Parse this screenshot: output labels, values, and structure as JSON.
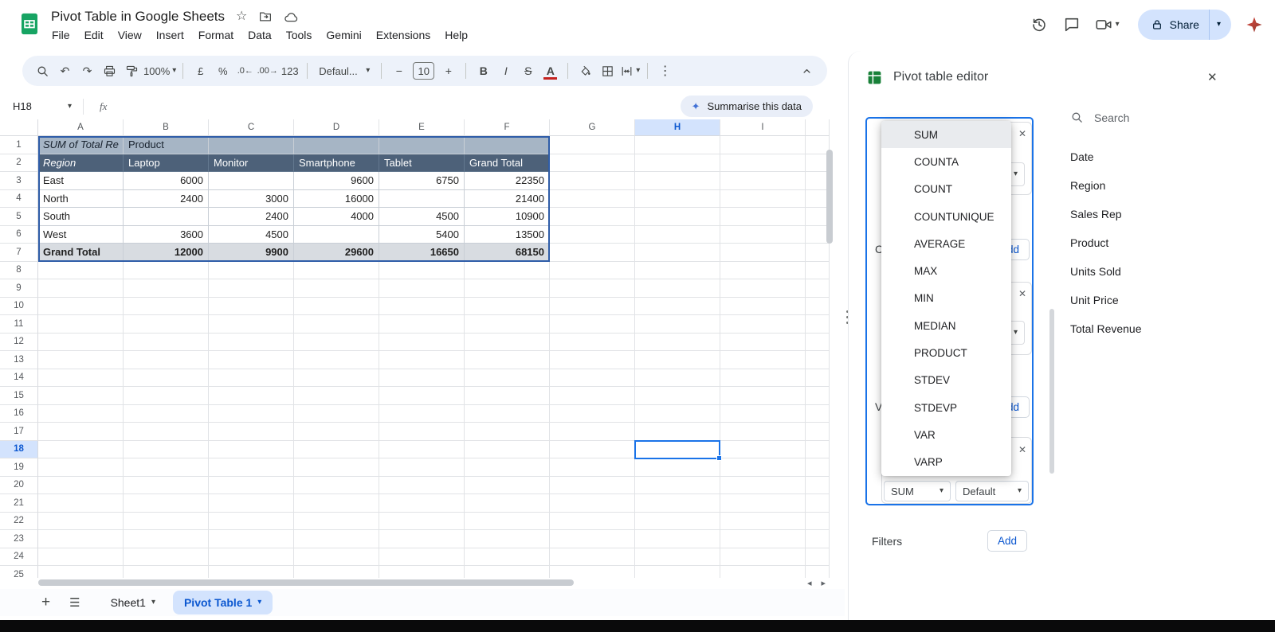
{
  "icons": {
    "undo": "↶",
    "redo": "↷",
    "caret": "▾",
    "star": "☆",
    "more_vertical": "⋮",
    "sparkle": "✦",
    "close": "✕",
    "plus": "+",
    "hamburger": "☰",
    "scroll_left": "◂",
    "scroll_right": "▸",
    "dec_decimal": ".0←",
    "inc_decimal": ".00→"
  },
  "app": {
    "title": "Pivot Table in Google Sheets",
    "menus": [
      "File",
      "Edit",
      "View",
      "Insert",
      "Format",
      "Data",
      "Tools",
      "Gemini",
      "Extensions",
      "Help"
    ],
    "share_label": "Share"
  },
  "toolbar": {
    "zoom": "100%",
    "currency": "£",
    "percent": "%",
    "number_format": "123",
    "font_name": "Defaul...",
    "font_size": "10",
    "minus": "−",
    "plus": "+",
    "bold": "B",
    "italic": "I",
    "strike": "S",
    "text_color": "A"
  },
  "formula_bar": {
    "cell_ref": "H18",
    "fx": "fx",
    "summarise": "Summarise this data"
  },
  "grid": {
    "columns": [
      "A",
      "B",
      "C",
      "D",
      "E",
      "F",
      "G",
      "H",
      "I"
    ],
    "row_count": 25,
    "selected_column": "H",
    "selected_row": 18,
    "selected_cell": "H18"
  },
  "pivot_table": {
    "a1": "SUM of Total Re",
    "b1": "Product",
    "row_header": "Region",
    "column_headers": [
      "Laptop",
      "Monitor",
      "Smartphone",
      "Tablet",
      "Grand Total"
    ],
    "rows": [
      {
        "label": "East",
        "values": [
          "6000",
          "",
          "9600",
          "6750",
          "22350"
        ]
      },
      {
        "label": "North",
        "values": [
          "2400",
          "3000",
          "16000",
          "",
          "21400"
        ]
      },
      {
        "label": "South",
        "values": [
          "",
          "2400",
          "4000",
          "4500",
          "10900"
        ]
      },
      {
        "label": "West",
        "values": [
          "3600",
          "4500",
          "",
          "5400",
          "13500"
        ]
      },
      {
        "label": "Grand Total",
        "values": [
          "12000",
          "9900",
          "29600",
          "16650",
          "68150"
        ],
        "total": true
      }
    ]
  },
  "tabs": {
    "sheet1": "Sheet1",
    "active": "Pivot Table 1"
  },
  "editor": {
    "title": "Pivot table editor",
    "search_placeholder": "Search",
    "fields": [
      "Date",
      "Region",
      "Sales Rep",
      "Product",
      "Units Sold",
      "Unit Price",
      "Total Revenue"
    ],
    "aggregations": [
      "SUM",
      "COUNTA",
      "COUNT",
      "COUNTUNIQUE",
      "AVERAGE",
      "MAX",
      "MIN",
      "MEDIAN",
      "PRODUCT",
      "STDEV",
      "STDEVP",
      "VAR",
      "VARP"
    ],
    "selected_aggregation": "SUM",
    "columns_label": "Columns",
    "values_label": "Values",
    "filters_label": "Filters",
    "add_label": "Add",
    "summarise_by_value": "SUM",
    "show_as_value": "Default"
  }
}
